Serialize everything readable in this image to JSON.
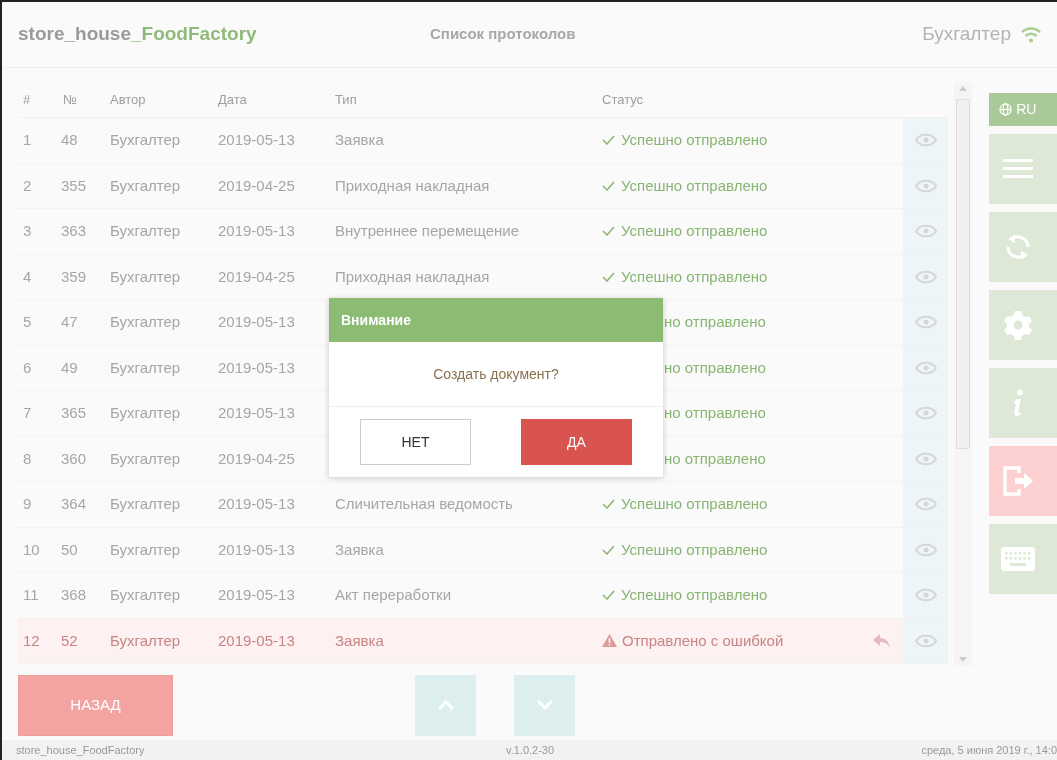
{
  "header": {
    "app_name": "store_house",
    "app_accent": "_FoodFactory",
    "title": "Список протоколов",
    "user": "Бухгалтер"
  },
  "table": {
    "columns": [
      "#",
      "№",
      "Автор",
      "Дата",
      "Тип",
      "Статус"
    ],
    "rows": [
      {
        "n": "1",
        "no": "48",
        "author": "Бухгалтер",
        "date": "2019-05-13",
        "type": "Заявка",
        "status": {
          "kind": "ok",
          "text": "Успешно отправлено"
        }
      },
      {
        "n": "2",
        "no": "355",
        "author": "Бухгалтер",
        "date": "2019-04-25",
        "type": "Приходная накладная",
        "status": {
          "kind": "ok",
          "text": "Успешно отправлено"
        }
      },
      {
        "n": "3",
        "no": "363",
        "author": "Бухгалтер",
        "date": "2019-05-13",
        "type": "Внутреннее перемещение",
        "status": {
          "kind": "ok",
          "text": "Успешно отправлено"
        }
      },
      {
        "n": "4",
        "no": "359",
        "author": "Бухгалтер",
        "date": "2019-04-25",
        "type": "Приходная накладная",
        "status": {
          "kind": "ok",
          "text": "Успешно отправлено"
        }
      },
      {
        "n": "5",
        "no": "47",
        "author": "Бухгалтер",
        "date": "2019-05-13",
        "status": {
          "kind": "covered",
          "text": "но отправлено"
        }
      },
      {
        "n": "6",
        "no": "49",
        "author": "Бухгалтер",
        "date": "2019-05-13",
        "status": {
          "kind": "covered",
          "text": "но отправлено"
        }
      },
      {
        "n": "7",
        "no": "365",
        "author": "Бухгалтер",
        "date": "2019-05-13",
        "status": {
          "kind": "covered",
          "text": "но отправлено"
        }
      },
      {
        "n": "8",
        "no": "360",
        "author": "Бухгалтер",
        "date": "2019-04-25",
        "status": {
          "kind": "covered",
          "text": "но отправлено"
        }
      },
      {
        "n": "9",
        "no": "364",
        "author": "Бухгалтер",
        "date": "2019-05-13",
        "type": "Сличительная ведомость",
        "status": {
          "kind": "ok",
          "text": "Успешно отправлено"
        }
      },
      {
        "n": "10",
        "no": "50",
        "author": "Бухгалтер",
        "date": "2019-05-13",
        "type": "Заявка",
        "status": {
          "kind": "ok",
          "text": "Успешно отправлено"
        }
      },
      {
        "n": "11",
        "no": "368",
        "author": "Бухгалтер",
        "date": "2019-05-13",
        "type": "Акт переработки",
        "status": {
          "kind": "ok",
          "text": "Успешно отправлено"
        }
      },
      {
        "n": "12",
        "no": "52",
        "author": "Бухгалтер",
        "date": "2019-05-13",
        "type": "Заявка",
        "status": {
          "kind": "error",
          "text": "Отправлено с ошибкой"
        },
        "resend": true
      }
    ]
  },
  "sidebar": [
    {
      "kind": "language",
      "label": "RU"
    },
    {
      "kind": "menu"
    },
    {
      "kind": "sync"
    },
    {
      "kind": "settings"
    },
    {
      "kind": "info"
    },
    {
      "kind": "exit"
    },
    {
      "kind": "keyboard"
    }
  ],
  "buttons": {
    "back": "НАЗАД"
  },
  "dialog": {
    "title": "Внимание",
    "message": "Создать документ?",
    "buttons": [
      {
        "kind": "cancel",
        "label": "НЕТ"
      },
      {
        "kind": "confirm",
        "label": "ДА"
      }
    ]
  },
  "footer": {
    "app": "store_house_FoodFactory",
    "version": "v.1.0.2-30",
    "datetime": "среда, 5 июня 2019 г., 14:0"
  }
}
